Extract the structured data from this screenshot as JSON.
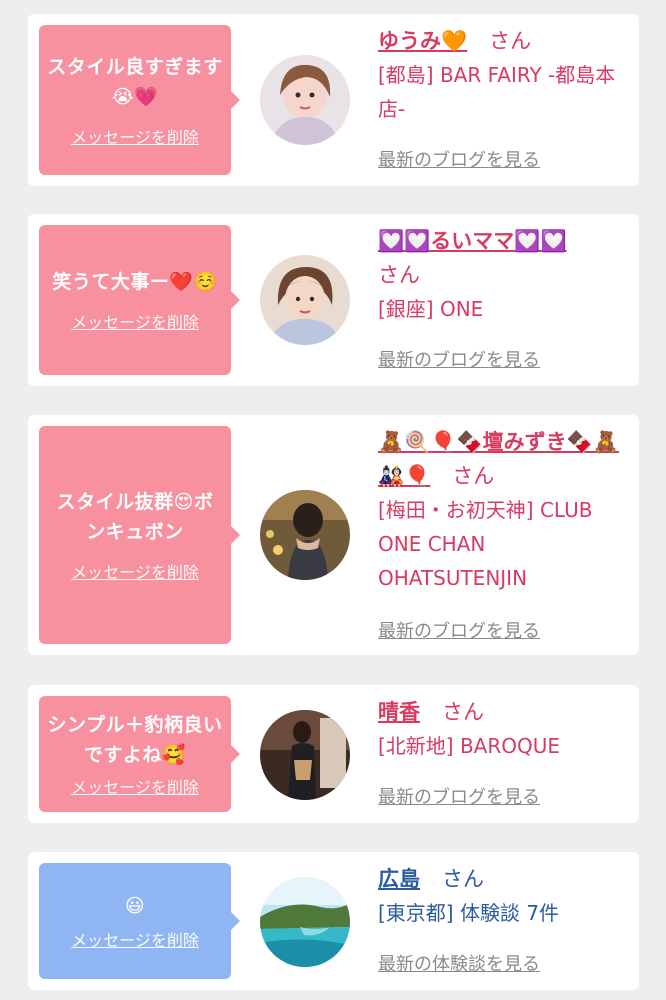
{
  "cards": [
    {
      "message": "スタイル良すぎます😭💗",
      "delete_label": "メッセージを削除",
      "name": "ゆうみ🧡",
      "honorific": "さん",
      "shop": "[都島] BAR FAIRY -都島本店-",
      "blog_link": "最新のブログを見る"
    },
    {
      "message": "笑うて大事ー❤️☺️",
      "delete_label": "メッセージを削除",
      "name": "💟💟るいママ💟💟",
      "honorific": "さん",
      "shop": "[銀座] ONE",
      "blog_link": "最新のブログを見る"
    },
    {
      "message": "スタイル抜群😍ボンキュボン",
      "delete_label": "メッセージを削除",
      "name": "🧸🍭🎈🍫壇みずき🍫🧸🎎🎈",
      "honorific": "さん",
      "shop": "[梅田・お初天神] CLUB ONE CHAN OHATSUTENJIN",
      "blog_link": "最新のブログを見る"
    },
    {
      "message": "シンプル＋豹柄良いですよね🥰",
      "delete_label": "メッセージを削除",
      "name": "晴香",
      "honorific": "さん",
      "shop": "[北新地] BAROQUE",
      "blog_link": "最新のブログを見る"
    },
    {
      "message": "😃",
      "delete_label": "メッセージを削除",
      "name": "広島",
      "honorific": "さん",
      "shop": "[東京都] 体験談 7件",
      "blog_link": "最新の体験談を見る"
    }
  ],
  "colors": {
    "pink_bubble": "#f7909f",
    "blue_bubble": "#8fb6f2",
    "name_pink": "#d83b60",
    "name_blue": "#2b5d9e"
  }
}
